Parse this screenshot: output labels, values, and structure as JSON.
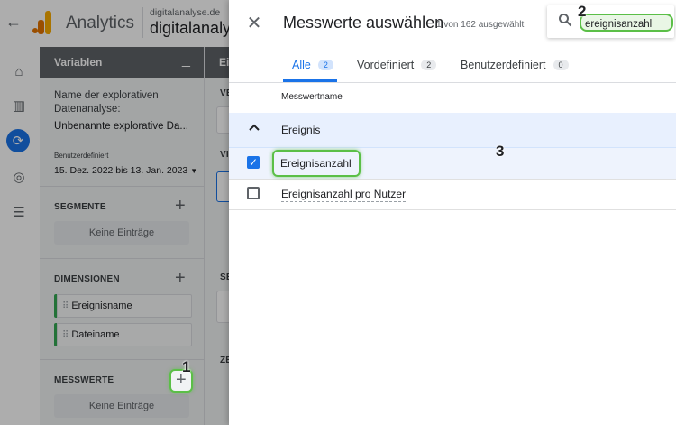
{
  "app": {
    "title": "Analytics",
    "property_line1": "digitalanalyse.de",
    "property_line2": "digitalanalyse"
  },
  "variables": {
    "header": "Variablen",
    "name_label": "Name der explorativen Datenanalyse:",
    "name_value": "Unbenannte explorative Da...",
    "date_label": "Benutzerdefiniert",
    "date_range": "15. Dez. 2022 bis 13. Jan. 2023",
    "segments": {
      "label": "SEGMENTE",
      "empty": "Keine Einträge"
    },
    "dimensions": {
      "label": "DIMENSIONEN",
      "items": [
        "Ereignisname",
        "Dateiname"
      ]
    },
    "metrics": {
      "label": "MESSWERTE",
      "empty": "Keine Einträge"
    }
  },
  "col3": {
    "header": "Ei",
    "labels": [
      "VE",
      "VI",
      "SE",
      "ZE"
    ]
  },
  "dialog": {
    "title": "Messwerte auswählen",
    "count": "1 von 162 ausgewählt",
    "search_value": "ereignisanzahl",
    "tabs": [
      {
        "label": "Alle",
        "count": "2"
      },
      {
        "label": "Vordefiniert",
        "count": "2"
      },
      {
        "label": "Benutzerdefiniert",
        "count": "0"
      }
    ],
    "column_header": "Messwertname",
    "group": "Ereignis",
    "rows": [
      {
        "label": "Ereignisanzahl",
        "checked": true
      },
      {
        "label": "Ereignisanzahl pro Nutzer",
        "checked": false
      }
    ]
  },
  "annotations": {
    "step1": "1",
    "step2": "2",
    "step3": "3"
  },
  "colors": {
    "accent": "#1a73e8",
    "highlight": "#5bbf47",
    "logo": "#f9ab00"
  }
}
